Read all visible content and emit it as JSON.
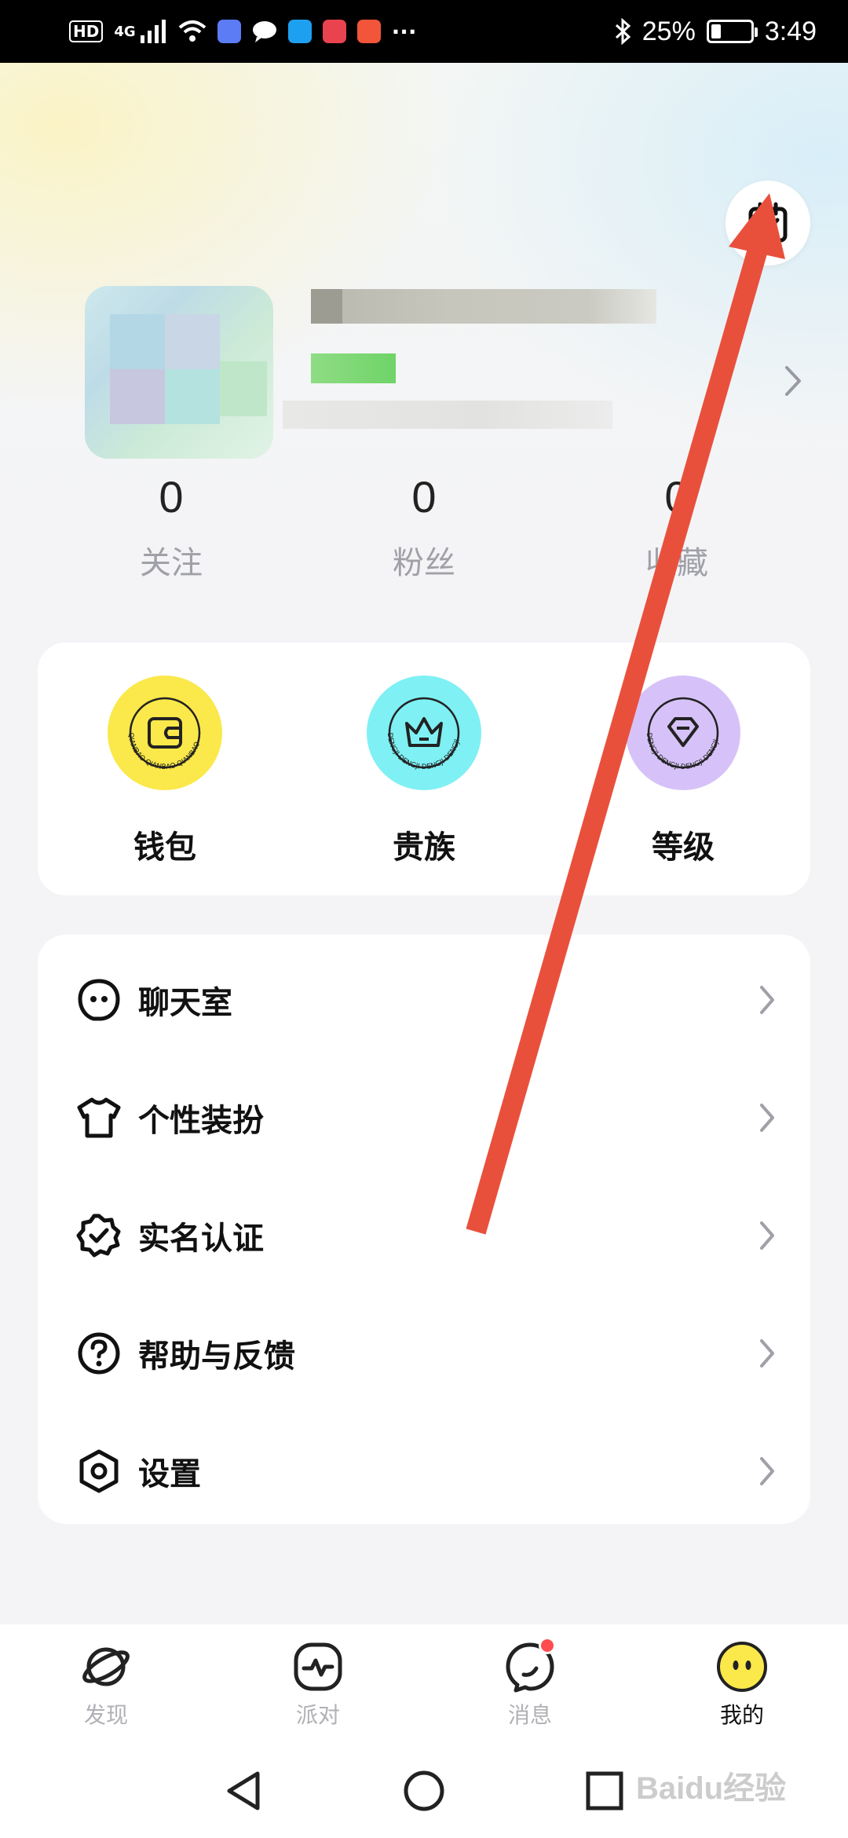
{
  "status_bar": {
    "hd": "HD",
    "network": "4G",
    "more": "···",
    "battery": "25%",
    "battery_level": 0.25,
    "time": "3:49"
  },
  "header": {
    "checkin_icon": "calendar-check-icon"
  },
  "stats": [
    {
      "value": "0",
      "label": "关注"
    },
    {
      "value": "0",
      "label": "粉丝"
    },
    {
      "value": "0",
      "label": "收藏"
    }
  ],
  "quick_actions": [
    {
      "label": "钱包",
      "icon": "wallet-icon",
      "color": "#fbe84a"
    },
    {
      "label": "贵族",
      "icon": "crown-icon",
      "color": "#7ff0f4"
    },
    {
      "label": "等级",
      "icon": "gem-icon",
      "color": "#d6c2f8"
    }
  ],
  "menu": [
    {
      "label": "聊天室",
      "icon": "chat-ghost-icon"
    },
    {
      "label": "个性装扮",
      "icon": "tshirt-icon"
    },
    {
      "label": "实名认证",
      "icon": "verified-badge-icon"
    },
    {
      "label": "帮助与反馈",
      "icon": "help-icon"
    },
    {
      "label": "设置",
      "icon": "settings-hex-icon"
    }
  ],
  "bottom_nav": [
    {
      "label": "发现",
      "icon": "planet-icon"
    },
    {
      "label": "派对",
      "icon": "party-pulse-icon"
    },
    {
      "label": "消息",
      "icon": "message-icon"
    },
    {
      "label": "我的",
      "icon": "smiley-icon"
    }
  ],
  "watermark": "Baidu经验",
  "colors": {
    "accent_yellow": "#fbe84a",
    "badge_red": "#ff4d4f",
    "annotation_red": "#e9503c"
  }
}
